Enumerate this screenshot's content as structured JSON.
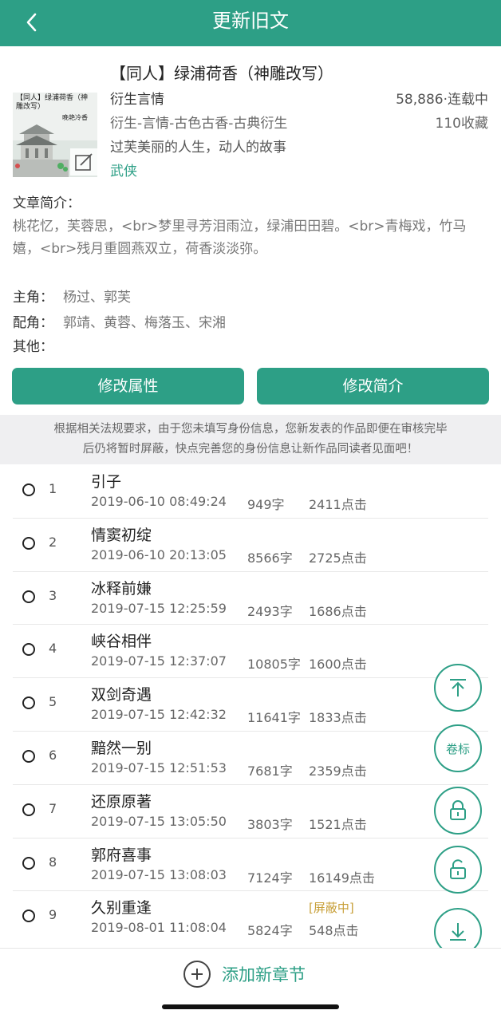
{
  "header": {
    "title": "更新旧文"
  },
  "book": {
    "title": "【同人】绿浦荷香（神雕改写）",
    "cover_title": "【同人】绿浦荷香（神雕改写）",
    "cover_author": "晚艳冷香",
    "genre": "衍生言情",
    "stats": "58,886·连载中",
    "tags": "衍生-言情-古色古香-古典衍生",
    "favorites": "110收藏",
    "tagline": "过芙美丽的人生，动人的故事",
    "category": "武侠",
    "intro_label": "文章简介：",
    "intro": "桃花忆，芙蓉思，<br>梦里寻芳泪雨泣，绿浦田田碧。<br>青梅戏，竹马嬉，<br>残月重圆燕双立，荷香淡淡弥。",
    "roles": {
      "main_label": "主角：",
      "main": "杨过、郭芙",
      "support_label": "配角：",
      "support": "郭靖、黄蓉、梅落玉、宋湘",
      "other_label": "其他：",
      "other": ""
    }
  },
  "actions": {
    "edit_attributes": "修改属性",
    "edit_intro": "修改简介"
  },
  "notice": {
    "line1": "根据相关法规要求，由于您未填写身份信息，您新发表的作品即便在审核完毕",
    "line2": "后仍将暂时屏蔽，快点完善您的身份信息让新作品同读者见面吧！"
  },
  "chapters": [
    {
      "num": "1",
      "title": "引子",
      "time": "2019-06-10 08:49:24",
      "words": "949字",
      "clicks": "2411点击",
      "status": ""
    },
    {
      "num": "2",
      "title": "情窦初绽",
      "time": "2019-06-10 20:13:05",
      "words": "8566字",
      "clicks": "2725点击",
      "status": ""
    },
    {
      "num": "3",
      "title": "冰释前嫌",
      "time": "2019-07-15 12:25:59",
      "words": "2493字",
      "clicks": "1686点击",
      "status": ""
    },
    {
      "num": "4",
      "title": "峡谷相伴",
      "time": "2019-07-15 12:37:07",
      "words": "10805字",
      "clicks": "1600点击",
      "status": ""
    },
    {
      "num": "5",
      "title": "双剑奇遇",
      "time": "2019-07-15 12:42:32",
      "words": "11641字",
      "clicks": "1833点击",
      "status": ""
    },
    {
      "num": "6",
      "title": "黯然一别",
      "time": "2019-07-15 12:51:53",
      "words": "7681字",
      "clicks": "2359点击",
      "status": ""
    },
    {
      "num": "7",
      "title": "还原原著",
      "time": "2019-07-15 13:05:50",
      "words": "3803字",
      "clicks": "1521点击",
      "status": ""
    },
    {
      "num": "8",
      "title": "郭府喜事",
      "time": "2019-07-15 13:08:03",
      "words": "7124字",
      "clicks": "16149点击",
      "status": ""
    },
    {
      "num": "9",
      "title": "久别重逢",
      "time": "2019-08-01 11:08:04",
      "words": "5824字",
      "clicks": "548点击",
      "status": "[屏蔽中]"
    }
  ],
  "fabs": {
    "volume_label": "卷标"
  },
  "bottom": {
    "add_chapter": "添加新章节"
  },
  "colors": {
    "primary": "#2d9f86",
    "status_blocked": "#c8a03a",
    "notice_bg": "#efeff1"
  }
}
